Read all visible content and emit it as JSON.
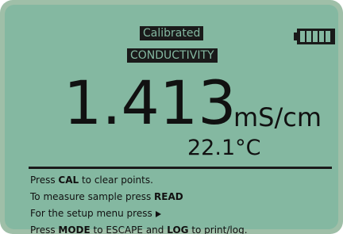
{
  "status": {
    "calibration": "Calibrated",
    "mode": "CONDUCTIVITY",
    "battery": {
      "icon": "battery-icon",
      "level": 1.0
    }
  },
  "measurement": {
    "value": "1.413",
    "unit": "mS/cm",
    "temperature": "22.1°C"
  },
  "instructions": {
    "line1": {
      "prefix": "Press ",
      "key": "CAL",
      "suffix": " to clear points."
    },
    "line2": {
      "prefix": "To measure sample press ",
      "key": "READ"
    },
    "line3": {
      "text": "For the setup menu press",
      "icon": "right-arrow-icon"
    },
    "line4": {
      "prefix": "Press ",
      "key1": "MODE",
      "middle": " to ESCAPE and ",
      "key2": "LOG",
      "suffix": " to print/log."
    }
  },
  "colors": {
    "lcd_background": "#84b8a1",
    "bezel": "#9fbfa8",
    "foreground": "#111111"
  }
}
